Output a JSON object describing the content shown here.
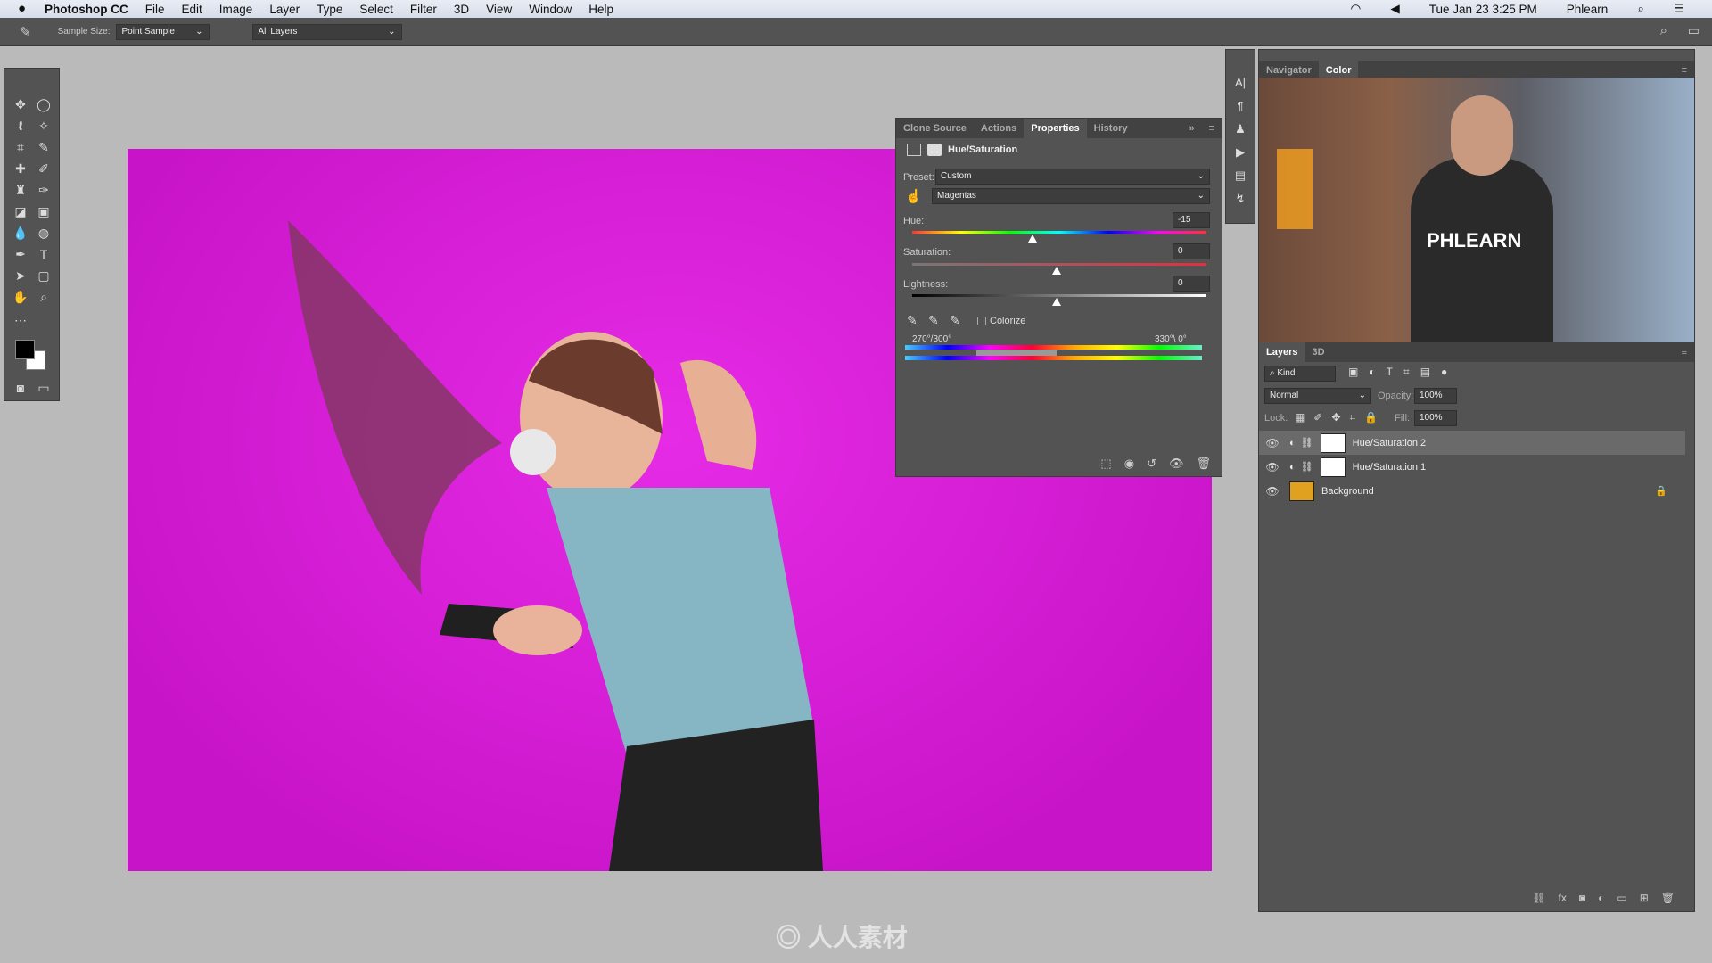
{
  "menubar": {
    "app": "Photoshop CC",
    "items": [
      "File",
      "Edit",
      "Image",
      "Layer",
      "Type",
      "Select",
      "Filter",
      "3D",
      "View",
      "Window",
      "Help"
    ],
    "datetime": "Tue Jan 23  3:25 PM",
    "user": "Phlearn"
  },
  "options": {
    "sample_size_label": "Sample Size:",
    "sample_size": "Point Sample",
    "layers": "All Layers"
  },
  "properties": {
    "tabs": [
      "Clone Source",
      "Actions",
      "Properties",
      "History"
    ],
    "active_tab": "Properties",
    "title": "Hue/Saturation",
    "preset_label": "Preset:",
    "preset": "Custom",
    "channel": "Magentas",
    "hue_label": "Hue:",
    "hue": "-15",
    "saturation_label": "Saturation:",
    "saturation": "0",
    "lightness_label": "Lightness:",
    "lightness": "0",
    "colorize_label": "Colorize",
    "range_left": "270°/300°",
    "range_right": "330°\\ 0°"
  },
  "navigator": {
    "tabs": [
      "Navigator",
      "Color"
    ],
    "active_tab": "Color",
    "shirt_text": "PHLEARN"
  },
  "layers": {
    "tabs": [
      "Layers",
      "3D"
    ],
    "kind": "Kind",
    "blend": "Normal",
    "opacity_label": "Opacity:",
    "opacity": "100%",
    "lock_label": "Lock:",
    "fill_label": "Fill:",
    "fill": "100%",
    "items": [
      {
        "name": "Hue/Saturation 2",
        "selected": true
      },
      {
        "name": "Hue/Saturation 1",
        "selected": false
      },
      {
        "name": "Background",
        "selected": false,
        "locked": true
      }
    ]
  },
  "watermark": "人人素材"
}
